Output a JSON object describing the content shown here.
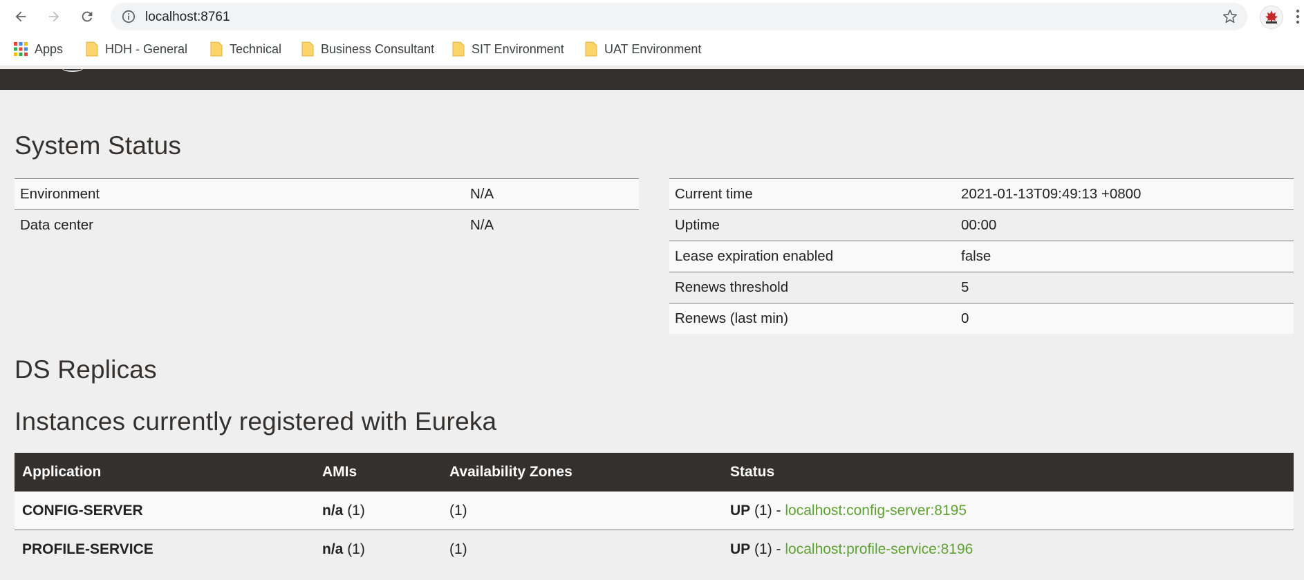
{
  "browser": {
    "url": "localhost:8761",
    "bookmarks": [
      {
        "label": "Apps"
      },
      {
        "label": "HDH - General"
      },
      {
        "label": "Technical"
      },
      {
        "label": "Business Consultant"
      },
      {
        "label": "SIT Environment"
      },
      {
        "label": "UAT Environment"
      }
    ],
    "icons": [
      "back-arrow-icon",
      "forward-arrow-icon",
      "reload-icon",
      "info-icon",
      "star-icon",
      "profile-avatar",
      "more-menu-icon",
      "apps-grid-icon",
      "folder-icon"
    ]
  },
  "colors": {
    "navbar": "#34302d",
    "page_bg": "#efefef",
    "link_green": "#5fa134"
  },
  "system_status": {
    "title": "System Status",
    "left": [
      {
        "key": "Environment",
        "value": "N/A"
      },
      {
        "key": "Data center",
        "value": "N/A"
      }
    ],
    "right": [
      {
        "key": "Current time",
        "value": "2021-01-13T09:49:13 +0800"
      },
      {
        "key": "Uptime",
        "value": "00:00"
      },
      {
        "key": "Lease expiration enabled",
        "value": "false"
      },
      {
        "key": "Renews threshold",
        "value": "5"
      },
      {
        "key": "Renews (last min)",
        "value": "0"
      }
    ]
  },
  "ds_replicas": {
    "title": "DS Replicas"
  },
  "instances": {
    "title": "Instances currently registered with Eureka",
    "columns": [
      "Application",
      "AMIs",
      "Availability Zones",
      "Status"
    ],
    "rows": [
      {
        "application": "CONFIG-SERVER",
        "amis_bold": "n/a",
        "amis_count": "(1)",
        "zones": "(1)",
        "status_bold": "UP",
        "status_count": "(1) -",
        "link": "localhost:config-server:8195"
      },
      {
        "application": "PROFILE-SERVICE",
        "amis_bold": "n/a",
        "amis_count": "(1)",
        "zones": "(1)",
        "status_bold": "UP",
        "status_count": "(1) -",
        "link": "localhost:profile-service:8196"
      }
    ]
  }
}
